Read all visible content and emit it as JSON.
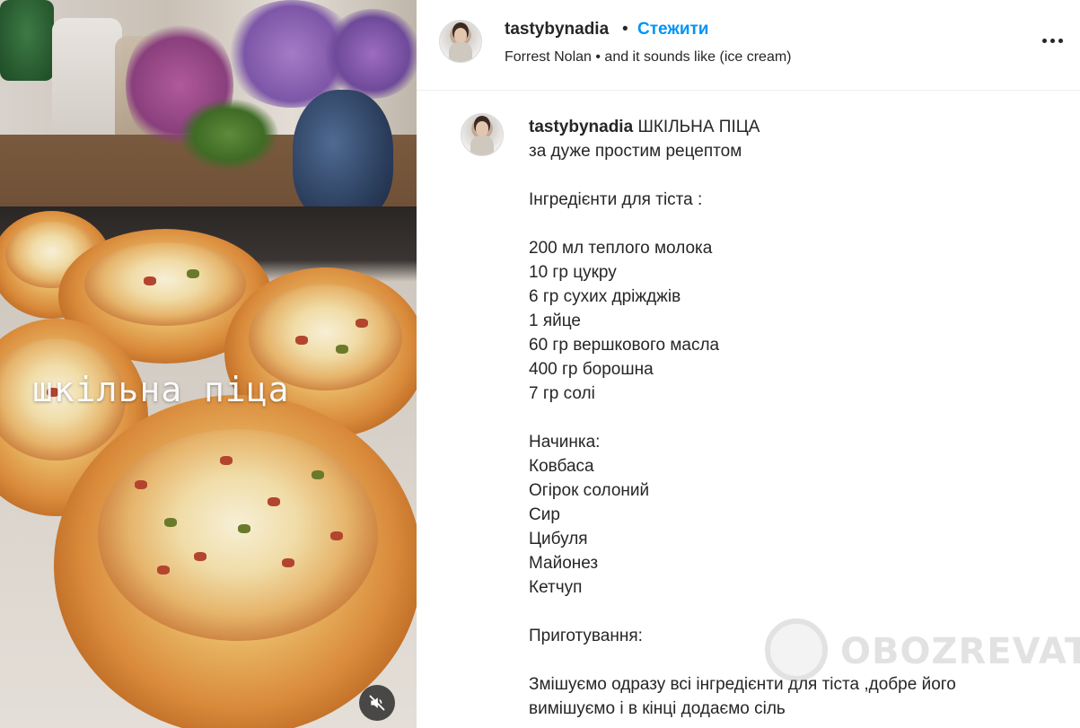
{
  "media": {
    "overlay_text": "шкільна піца",
    "mute_icon": "speaker-muted-icon"
  },
  "header": {
    "username": "tastybynadia",
    "separator": "•",
    "follow_label": "Стежити",
    "audio": "Forrest Nolan • and it sounds like (ice cream)",
    "more_icon": "more-horizontal-icon"
  },
  "caption": {
    "username": "tastybynadia",
    "title": "ШКІЛЬНА ПІЦА",
    "lines": [
      "за дуже простим рецептом",
      "",
      "Інгредієнти для тіста :",
      "",
      "200 мл теплого молока",
      "10 гр цукру",
      "6 гр сухих дріжджів",
      "1 яйце",
      "60 гр вершкового масла",
      "400 гр борошна",
      "7 гр солі",
      "",
      "Начинка:",
      "Ковбаса",
      "Огірок солоний",
      "Сир",
      "Цибуля",
      "Майонез",
      "Кетчуп",
      "",
      "Приготування:",
      "",
      "Змішуємо одразу всі інгредієнти для тіста ,добре його",
      "вимішуємо і в кінці додаємо сіль"
    ]
  },
  "watermark": {
    "text": "OBOZREVATEL"
  },
  "colors": {
    "link_blue": "#0095f6",
    "text": "#262626",
    "divider": "#efefef"
  }
}
